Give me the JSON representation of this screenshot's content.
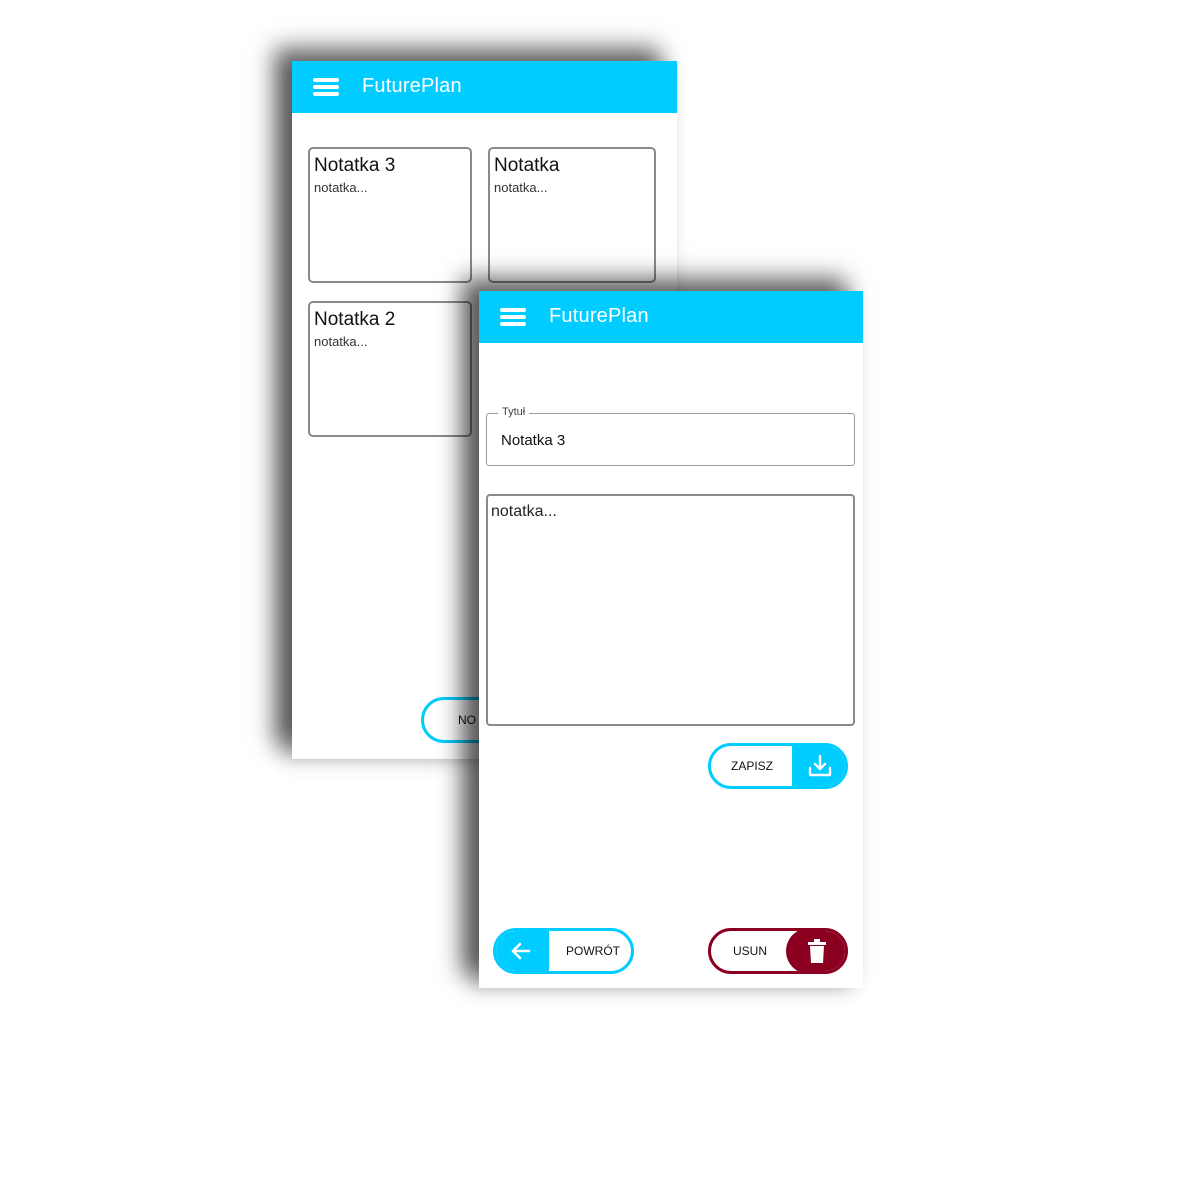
{
  "app": {
    "title": "FuturePlan"
  },
  "list_screen": {
    "notes": [
      {
        "title": "Notatka 3",
        "body": "notatka..."
      },
      {
        "title": "Notatka",
        "body": "notatka..."
      },
      {
        "title": "Notatka 2",
        "body": "notatka..."
      }
    ],
    "new_button_label_visible": "NO"
  },
  "edit_screen": {
    "title_field": {
      "legend": "Tytuł",
      "value": "Notatka 3"
    },
    "content_field": {
      "value": "notatka..."
    },
    "buttons": {
      "save_label": "ZAPISZ",
      "back_label": "POWRÓT",
      "delete_label": "USUN"
    }
  },
  "icons": {
    "menu": "menu-icon",
    "save": "download-icon",
    "back": "arrow-left-icon",
    "delete": "trash-icon"
  },
  "colors": {
    "accent": "#00ccff",
    "danger": "#8b0020",
    "border": "#8a8a8a"
  }
}
